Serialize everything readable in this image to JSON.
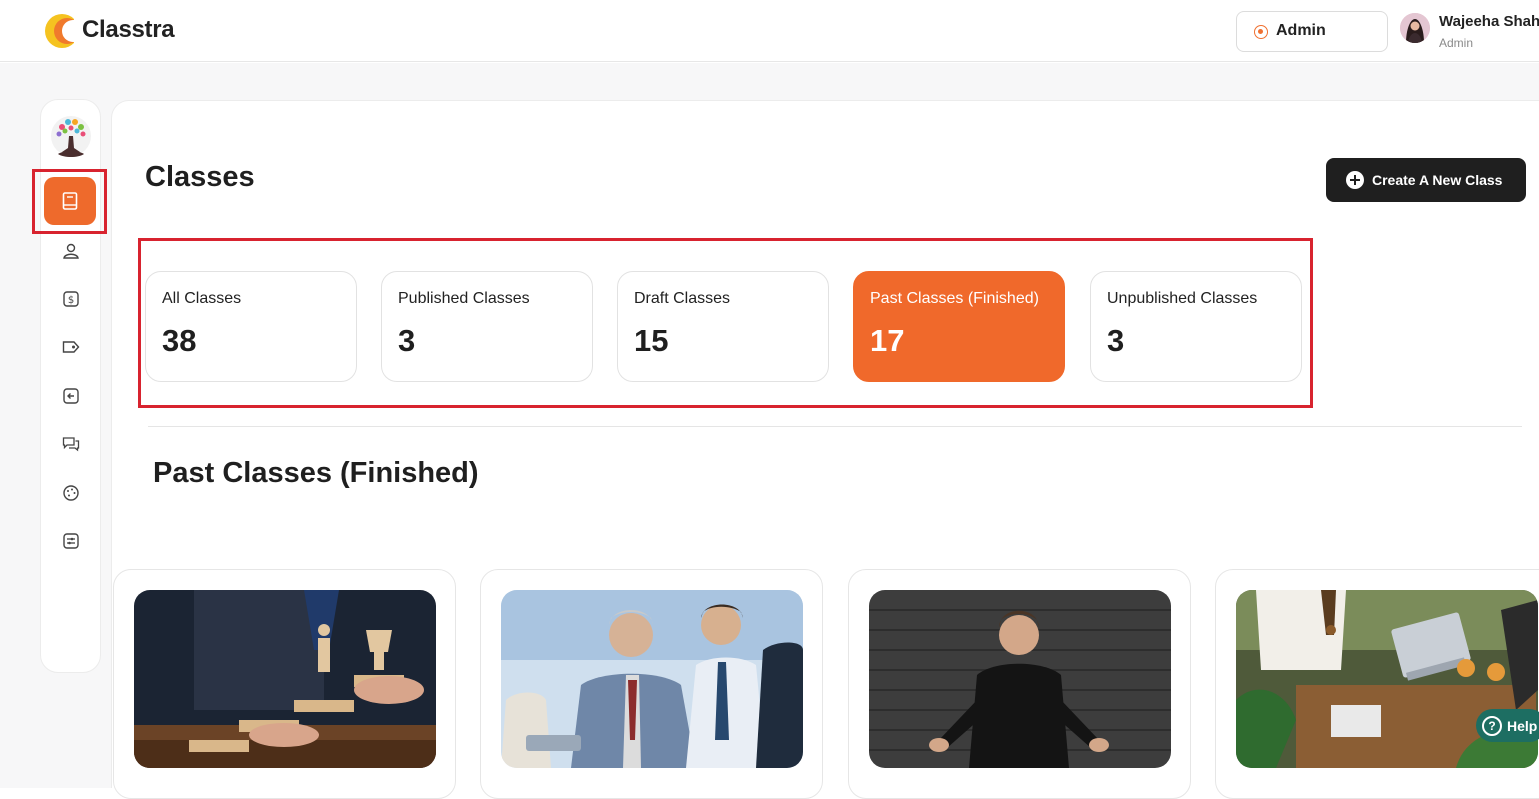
{
  "header": {
    "brand": "Classtra",
    "role_select": "Admin",
    "user_name": "Wajeeha Shah",
    "user_role": "Admin"
  },
  "sidebar": {
    "items": [
      {
        "icon": "book-icon",
        "active": true
      },
      {
        "icon": "user-icon"
      },
      {
        "icon": "dollar-icon"
      },
      {
        "icon": "tag-icon"
      },
      {
        "icon": "arrow-left-box-icon"
      },
      {
        "icon": "chat-icon"
      },
      {
        "icon": "palette-icon"
      },
      {
        "icon": "sliders-icon"
      }
    ]
  },
  "main": {
    "title": "Classes",
    "create_button": "Create A New Class",
    "stats": [
      {
        "label": "All Classes",
        "value": "38"
      },
      {
        "label": "Published Classes",
        "value": "3"
      },
      {
        "label": "Draft Classes",
        "value": "15"
      },
      {
        "label": "Past Classes (Finished)",
        "value": "17",
        "active": true
      },
      {
        "label": "Unpublished Classes",
        "value": "3"
      }
    ],
    "section_title": "Past Classes (Finished)",
    "cards": [
      {
        "image": "wooden-figure-trophy-photo"
      },
      {
        "image": "business-meeting-photo"
      },
      {
        "image": "speaker-brick-wall-photo"
      },
      {
        "image": "team-table-laptops-photo"
      }
    ]
  },
  "help": {
    "label": "Help"
  },
  "colors": {
    "accent": "#ee6a2c",
    "dark": "#1f1f1f",
    "highlight": "#d8232f",
    "help": "#1d6e62"
  }
}
